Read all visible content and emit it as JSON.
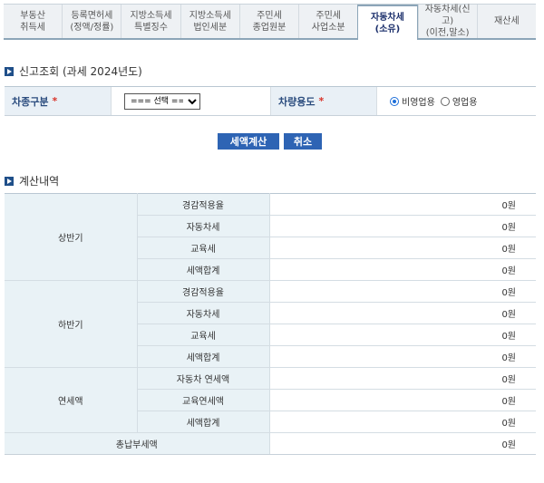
{
  "tabs": [
    {
      "label": "부동산\n취득세",
      "active": false
    },
    {
      "label": "등록면허세\n(정액/정률)",
      "active": false
    },
    {
      "label": "지방소득세\n특별징수",
      "active": false
    },
    {
      "label": "지방소득세\n법인세분",
      "active": false
    },
    {
      "label": "주민세\n종업원분",
      "active": false
    },
    {
      "label": "주민세\n사업소분",
      "active": false
    },
    {
      "label": "자동차세\n(소유)",
      "active": true
    },
    {
      "label": "자동차세(신고)\n(이전,말소)",
      "active": false
    },
    {
      "label": "재산세",
      "active": false
    }
  ],
  "query": {
    "title": "신고조회 (과세 2024년도)",
    "vehicle_type_label": "차종구분",
    "vehicle_type_value": "=== 선택 ===",
    "vehicle_use_label": "차량용도",
    "required_mark": "*",
    "radio_options": [
      {
        "label": "비영업용",
        "selected": true
      },
      {
        "label": "영업용",
        "selected": false
      }
    ]
  },
  "buttons": {
    "calculate": "세액계산",
    "cancel": "취소"
  },
  "result": {
    "title": "계산내역",
    "groups": [
      {
        "name": "상반기",
        "rows": [
          {
            "label": "경감적용율",
            "value": "0원"
          },
          {
            "label": "자동차세",
            "value": "0원"
          },
          {
            "label": "교육세",
            "value": "0원"
          },
          {
            "label": "세액합계",
            "value": "0원"
          }
        ]
      },
      {
        "name": "하반기",
        "rows": [
          {
            "label": "경감적용율",
            "value": "0원"
          },
          {
            "label": "자동차세",
            "value": "0원"
          },
          {
            "label": "교육세",
            "value": "0원"
          },
          {
            "label": "세액합계",
            "value": "0원"
          }
        ]
      },
      {
        "name": "연세액",
        "rows": [
          {
            "label": "자동차 연세액",
            "value": "0원"
          },
          {
            "label": "교육연세액",
            "value": "0원"
          },
          {
            "label": "세액합계",
            "value": "0원"
          }
        ]
      }
    ],
    "total": {
      "label": "총납부세액",
      "value": "0원"
    }
  },
  "colors": {
    "accent": "#2e64b4",
    "header_bg": "#e9f2f6",
    "required": "#d9342b"
  }
}
